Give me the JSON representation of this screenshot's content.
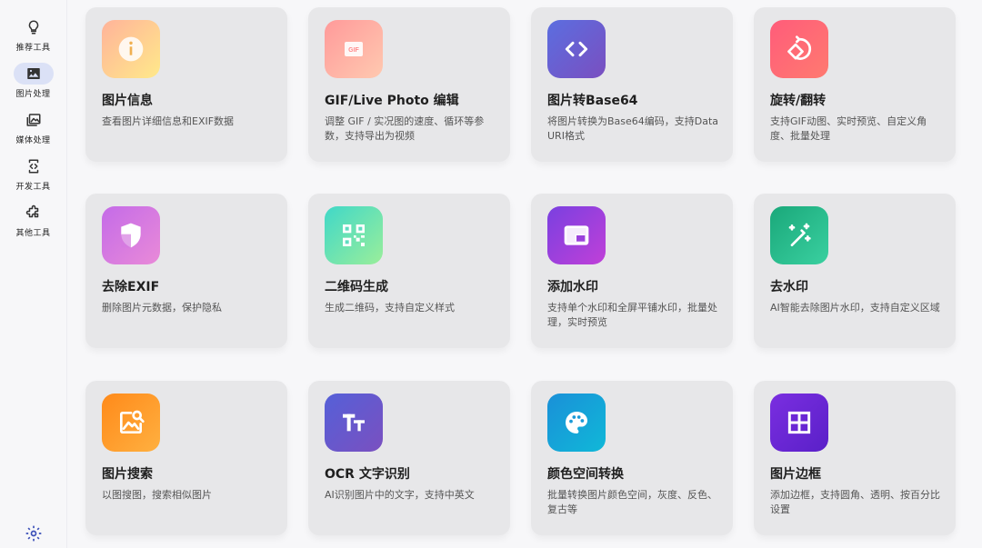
{
  "sidebar": {
    "items": [
      {
        "label": "推荐工具",
        "icon": "lightbulb-icon"
      },
      {
        "label": "图片处理",
        "icon": "image-icon"
      },
      {
        "label": "媒体处理",
        "icon": "media-icon"
      },
      {
        "label": "开发工具",
        "icon": "code-icon"
      },
      {
        "label": "其他工具",
        "icon": "puzzle-icon"
      }
    ],
    "active_index": 1,
    "settings_icon": "gear-icon"
  },
  "tools": [
    {
      "title": "图片信息",
      "desc": "查看图片详细信息和EXIF数据",
      "icon": "info-icon",
      "gradient": [
        "#ffb39a",
        "#ffe98a"
      ]
    },
    {
      "title": "GIF/Live Photo 编辑",
      "desc": "调整 GIF / 实况图的速度、循环等参数，支持导出为视频",
      "icon": "gif-icon",
      "gradient": [
        "#ff9a9a",
        "#ffc9b0"
      ]
    },
    {
      "title": "图片转Base64",
      "desc": "将图片转换为Base64编码，支持Data URI格式",
      "icon": "code-brackets-icon",
      "gradient": [
        "#5b6ee0",
        "#7a4fc0"
      ]
    },
    {
      "title": "旋转/翻转",
      "desc": "支持GIF动图、实时预览、自定义角度、批量处理",
      "icon": "rotate-icon",
      "gradient": [
        "#ff5c7a",
        "#ff7a70"
      ]
    },
    {
      "title": "去除EXIF",
      "desc": "删除图片元数据，保护隐私",
      "icon": "shield-icon",
      "gradient": [
        "#c46be8",
        "#e98ad8"
      ]
    },
    {
      "title": "二维码生成",
      "desc": "生成二维码，支持自定义样式",
      "icon": "qrcode-icon",
      "gradient": [
        "#40d8c8",
        "#9aee9a"
      ]
    },
    {
      "title": "添加水印",
      "desc": "支持单个水印和全屏平铺水印，批量处理，实时预览",
      "icon": "watermark-icon",
      "gradient": [
        "#7a40e0",
        "#c040d8"
      ]
    },
    {
      "title": "去水印",
      "desc": "AI智能去除图片水印，支持自定义区域",
      "icon": "magic-wand-icon",
      "gradient": [
        "#1aa87a",
        "#3ad0a0"
      ]
    },
    {
      "title": "图片搜索",
      "desc": "以图搜图，搜索相似图片",
      "icon": "image-search-icon",
      "gradient": [
        "#ff8a1a",
        "#ffb040"
      ]
    },
    {
      "title": "OCR 文字识别",
      "desc": "AI识别图片中的文字，支持中英文",
      "icon": "text-icon",
      "gradient": [
        "#5560d8",
        "#7a50c0"
      ]
    },
    {
      "title": "颜色空间转换",
      "desc": "批量转换图片颜色空间，灰度、反色、复古等",
      "icon": "palette-icon",
      "gradient": [
        "#1a90d8",
        "#10b8d8"
      ]
    },
    {
      "title": "图片边框",
      "desc": "添加边框，支持圆角、透明、按百分比设置",
      "icon": "grid-icon",
      "gradient": [
        "#7a2ee0",
        "#5a20c8"
      ]
    }
  ]
}
